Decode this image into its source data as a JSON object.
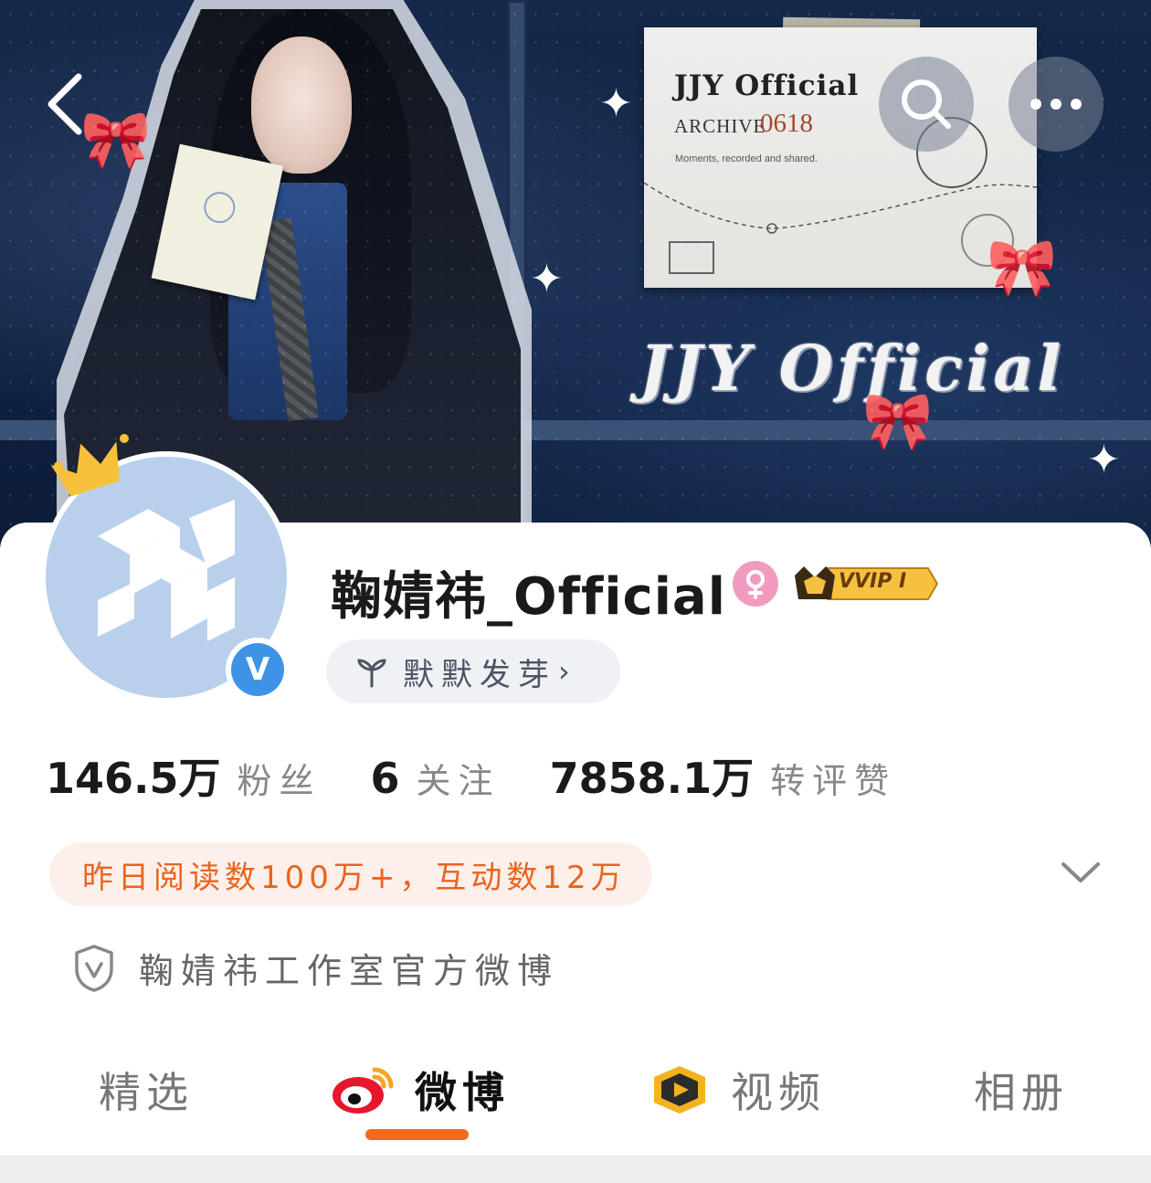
{
  "banner": {
    "card_title": "JJY Official",
    "card_archive_label": "ARCHIVE",
    "card_archive_number": "0618",
    "card_caption": "Moments, recorded and shared.",
    "stamp_text": "0618",
    "mini_card_text": "JJY Official",
    "logo_text": "JJY Official"
  },
  "nav": {
    "back_icon": "chevron-left-icon",
    "search_icon": "search-icon",
    "more_icon": "more-horizontal-icon"
  },
  "profile": {
    "username": "鞠婧祎_Official",
    "gender": "female",
    "vip_badge": "VVIP I",
    "sprout_label": "默默发芽",
    "sprout_chevron": "›",
    "verified_mark": "V",
    "avatar_monogram": "JJY"
  },
  "stats": [
    {
      "value": "146.5万",
      "label": "粉丝"
    },
    {
      "value": "6",
      "label": "关注"
    },
    {
      "value": "7858.1万",
      "label": "转评赞"
    }
  ],
  "read_info": "昨日阅读数100万+，互动数12万",
  "description": "鞠婧祎工作室官方微博",
  "tabs": [
    {
      "label": "精选",
      "active": false
    },
    {
      "label": "微博",
      "active": true
    },
    {
      "label": "视频",
      "active": false
    },
    {
      "label": "相册",
      "active": false
    }
  ],
  "colors": {
    "accent": "#f26a1b",
    "read_text": "#e9641e",
    "read_bg": "#fdf0eb",
    "verified": "#3f93e6",
    "gender_pink": "#f29bc0",
    "avatar_bg": "#b9d0ec",
    "banner_navy": "#102242"
  }
}
